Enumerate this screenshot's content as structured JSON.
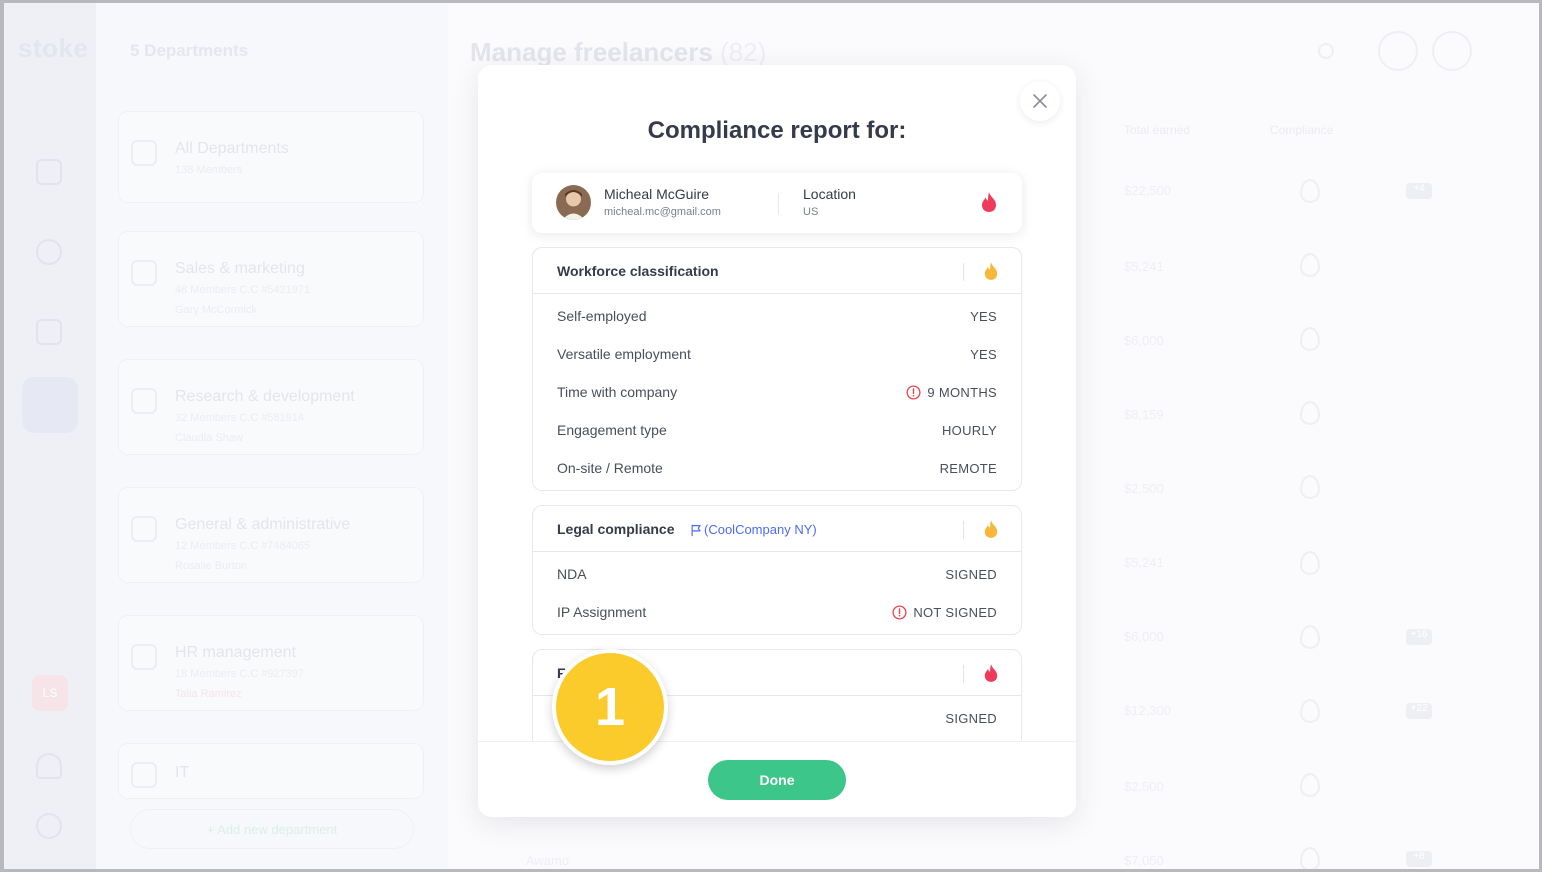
{
  "app": {
    "logo": "stoke",
    "sidebar_avatar_initials": "LS"
  },
  "departments": {
    "title": "5 Departments",
    "items": [
      {
        "name": "All Departments",
        "sub": "138 Members"
      },
      {
        "name": "Sales & marketing",
        "sub": "48 Members   C.C #5421971",
        "owner": "Gary McCormick"
      },
      {
        "name": "Research & development",
        "sub": "32 Members   C.C #581914",
        "owner": "Claudia Shaw"
      },
      {
        "name": "General & administrative",
        "sub": "12 Members   C.C #7484065",
        "owner": "Rosalie Burton"
      },
      {
        "name": "HR management",
        "sub": "18 Members   C.C #927397",
        "owner": "Talia Ramirez"
      },
      {
        "name": "IT",
        "sub": ""
      }
    ],
    "add_label": "+ Add new department"
  },
  "main": {
    "title": "Manage freelancers",
    "count": "(82)",
    "columns": {
      "total_earned": "Total earned",
      "compliance": "Compliance"
    },
    "amounts": [
      "$22,500",
      "$5,241",
      "$6,000",
      "$8,159",
      "$2,500",
      "$5,241",
      "$6,000",
      "$12,300",
      "$2,500",
      "$7,050"
    ],
    "tags": [
      "+4",
      "+16",
      "+22",
      "+8"
    ],
    "last_row_name": "Awamo"
  },
  "modal": {
    "title": "Compliance report for:",
    "person": {
      "name": "Micheal McGuire",
      "email": "micheal.mc@gmail.com",
      "location_label": "Location",
      "location_value": "US"
    },
    "sections": {
      "workforce": {
        "title": "Workforce classification",
        "rows": [
          {
            "label": "Self-employed",
            "value": "YES"
          },
          {
            "label": "Versatile employment",
            "value": "YES"
          },
          {
            "label": "Time with company",
            "value": "9 MONTHS",
            "warning": true
          },
          {
            "label": "Engagement type",
            "value": "HOURLY"
          },
          {
            "label": "On-site / Remote",
            "value": "REMOTE"
          }
        ]
      },
      "legal": {
        "title": "Legal compliance",
        "tag": "(CoolCompany NY)",
        "rows": [
          {
            "label": "NDA",
            "value": "SIGNED"
          },
          {
            "label": "IP Assignment",
            "value": "NOT SIGNED",
            "warning": true
          }
        ]
      },
      "third": {
        "title": "F",
        "rows": [
          {
            "label": "",
            "value": "SIGNED"
          }
        ]
      }
    },
    "done_label": "Done"
  },
  "step_badge": "1",
  "colors": {
    "accent_green": "#3cc689",
    "flame_red": "#ee3b5b",
    "flame_orange": "#f5b83a",
    "warning_red": "#e5484d",
    "link_blue": "#4b6cf0",
    "badge_yellow": "#fbcb2b"
  }
}
